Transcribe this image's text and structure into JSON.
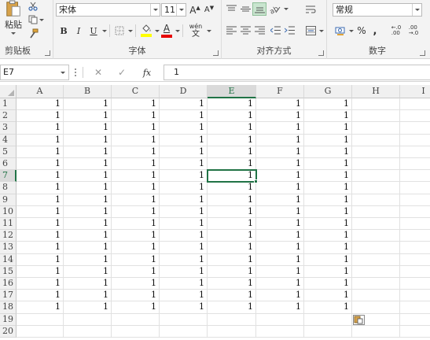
{
  "ribbon": {
    "clipboard": {
      "paste_label": "粘贴",
      "group_label": "剪贴板"
    },
    "font": {
      "font_name": "宋体",
      "font_size": "11",
      "bold": "B",
      "italic": "I",
      "underline": "U",
      "grow": "A",
      "shrink": "A",
      "font_color_glyph": "A",
      "phonetic_top": "wén",
      "phonetic_bottom": "文",
      "group_label": "字体"
    },
    "alignment": {
      "group_label": "对齐方式"
    },
    "number": {
      "format": "常规",
      "percent": "%",
      "comma": ",",
      "inc_decimal": "←.0\n.00",
      "dec_decimal": ".00\n→.0",
      "group_label": "数字"
    }
  },
  "formula_bar": {
    "name_box": "E7",
    "cancel": "✕",
    "confirm": "✓",
    "fx": "fx",
    "content": "1"
  },
  "sheet": {
    "columns": [
      "A",
      "B",
      "C",
      "D",
      "E",
      "F",
      "G",
      "H",
      "I"
    ],
    "rows": [
      "1",
      "2",
      "3",
      "4",
      "5",
      "6",
      "7",
      "8",
      "9",
      "10",
      "11",
      "12",
      "13",
      "14",
      "15",
      "16",
      "17",
      "18",
      "19",
      "20"
    ],
    "selected_column": "E",
    "selected_row": "7",
    "cell_values": [
      [
        "1",
        "1",
        "1",
        "1",
        "1",
        "1",
        "1",
        "",
        ""
      ],
      [
        "1",
        "1",
        "1",
        "1",
        "1",
        "1",
        "1",
        "",
        ""
      ],
      [
        "1",
        "1",
        "1",
        "1",
        "1",
        "1",
        "1",
        "",
        ""
      ],
      [
        "1",
        "1",
        "1",
        "1",
        "1",
        "1",
        "1",
        "",
        ""
      ],
      [
        "1",
        "1",
        "1",
        "1",
        "1",
        "1",
        "1",
        "",
        ""
      ],
      [
        "1",
        "1",
        "1",
        "1",
        "1",
        "1",
        "1",
        "",
        ""
      ],
      [
        "1",
        "1",
        "1",
        "1",
        "1",
        "1",
        "1",
        "",
        ""
      ],
      [
        "1",
        "1",
        "1",
        "1",
        "1",
        "1",
        "1",
        "",
        ""
      ],
      [
        "1",
        "1",
        "1",
        "1",
        "1",
        "1",
        "1",
        "",
        ""
      ],
      [
        "1",
        "1",
        "1",
        "1",
        "1",
        "1",
        "1",
        "",
        ""
      ],
      [
        "1",
        "1",
        "1",
        "1",
        "1",
        "1",
        "1",
        "",
        ""
      ],
      [
        "1",
        "1",
        "1",
        "1",
        "1",
        "1",
        "1",
        "",
        ""
      ],
      [
        "1",
        "1",
        "1",
        "1",
        "1",
        "1",
        "1",
        "",
        ""
      ],
      [
        "1",
        "1",
        "1",
        "1",
        "1",
        "1",
        "1",
        "",
        ""
      ],
      [
        "1",
        "1",
        "1",
        "1",
        "1",
        "1",
        "1",
        "",
        ""
      ],
      [
        "1",
        "1",
        "1",
        "1",
        "1",
        "1",
        "1",
        "",
        ""
      ],
      [
        "1",
        "1",
        "1",
        "1",
        "1",
        "1",
        "1",
        "",
        ""
      ],
      [
        "1",
        "1",
        "1",
        "1",
        "1",
        "1",
        "1",
        "",
        ""
      ],
      [
        "",
        "",
        "",
        "",
        "",
        "",
        "",
        "",
        ""
      ],
      [
        "",
        "",
        "",
        "",
        "",
        "",
        "",
        "",
        ""
      ]
    ]
  },
  "colors": {
    "accent_green": "#217346",
    "highlight_yellow": "#ffff00",
    "font_color_red": "#e60000"
  }
}
